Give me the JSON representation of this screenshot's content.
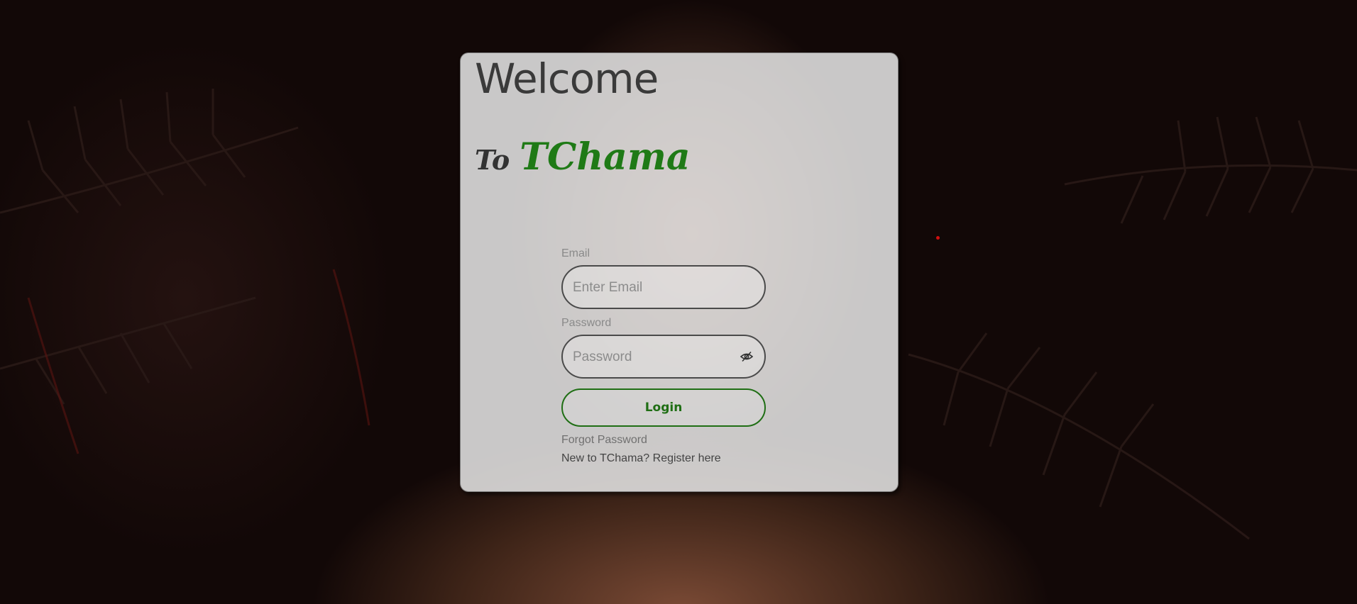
{
  "app": {
    "brand": "TChama",
    "accent_color": "#1f7a16"
  },
  "hero": {
    "welcome": "Welcome",
    "to": "To",
    "brand": "TChama"
  },
  "form": {
    "email_label": "Email",
    "email_placeholder": "Enter Email",
    "password_label": "Password",
    "password_placeholder": "Password",
    "password_toggle_icon": "eye-slash-icon",
    "login_label": "Login",
    "forgot_label": "Forgot Password",
    "register_label": "New to TChama? Register here"
  }
}
